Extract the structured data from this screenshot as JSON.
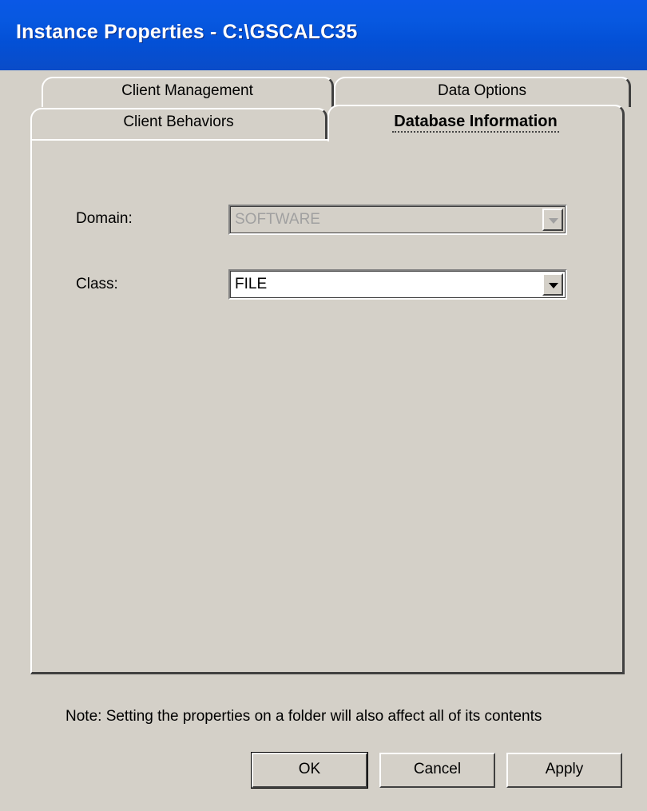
{
  "window": {
    "title": "Instance Properties - C:\\GSCALC35"
  },
  "tabs": {
    "client_management": "Client Management",
    "data_options": "Data Options",
    "client_behaviors": "Client Behaviors",
    "database_information": "Database Information",
    "active": "Database Information"
  },
  "form": {
    "domain_label": "Domain:",
    "domain_value": "SOFTWARE",
    "domain_enabled": false,
    "class_label": "Class:",
    "class_value": "FILE",
    "class_enabled": true
  },
  "note": "Note: Setting the properties on a folder will also affect all of its contents",
  "buttons": {
    "ok": "OK",
    "cancel": "Cancel",
    "apply": "Apply"
  },
  "icons": {
    "dropdown": "chevron-down-icon"
  }
}
